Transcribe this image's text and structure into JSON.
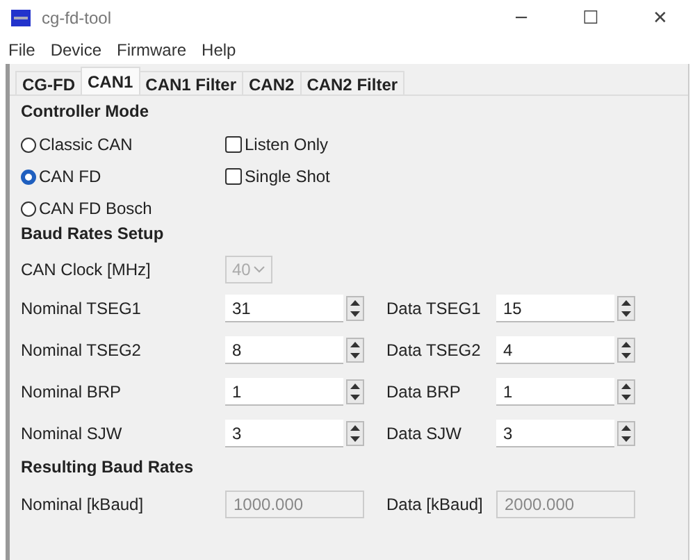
{
  "window": {
    "title": "cg-fd-tool",
    "controls": [
      "─",
      "☐",
      "✕"
    ]
  },
  "menu": [
    "File",
    "Device",
    "Firmware",
    "Help"
  ],
  "tabs": [
    {
      "label": "CG-FD",
      "selected": false
    },
    {
      "label": "CAN1",
      "selected": true
    },
    {
      "label": "CAN1 Filter",
      "selected": false
    },
    {
      "label": "CAN2",
      "selected": false
    },
    {
      "label": "CAN2 Filter",
      "selected": false
    }
  ],
  "controller_mode": {
    "title": "Controller Mode",
    "modes": [
      {
        "label": "Classic CAN",
        "selected": false
      },
      {
        "label": "CAN FD",
        "selected": true
      },
      {
        "label": "CAN FD Bosch",
        "selected": false
      }
    ],
    "options": [
      {
        "label": "Listen Only",
        "checked": false
      },
      {
        "label": "Single Shot",
        "checked": false
      }
    ]
  },
  "baud_rates_setup": {
    "title": "Baud Rates Setup",
    "can_clock": {
      "label": "CAN Clock [MHz]",
      "value": "40",
      "disabled": true
    },
    "rows": [
      {
        "nominal": {
          "label": "Nominal TSEG1",
          "value": "31"
        },
        "data": {
          "label": "Data TSEG1",
          "value": "15"
        }
      },
      {
        "nominal": {
          "label": "Nominal TSEG2",
          "value": "8"
        },
        "data": {
          "label": "Data TSEG2",
          "value": "4"
        }
      },
      {
        "nominal": {
          "label": "Nominal BRP",
          "value": "1"
        },
        "data": {
          "label": "Data BRP",
          "value": "1"
        }
      },
      {
        "nominal": {
          "label": "Nominal SJW",
          "value": "3"
        },
        "data": {
          "label": "Data SJW",
          "value": "3"
        }
      }
    ]
  },
  "resulting_baud_rates": {
    "title": "Resulting Baud Rates",
    "rows": [
      {
        "nominal": {
          "label": "Nominal [kBaud]",
          "value": "1000.000"
        },
        "data": {
          "label": "Data [kBaud]",
          "value": "2000.000"
        }
      }
    ]
  }
}
